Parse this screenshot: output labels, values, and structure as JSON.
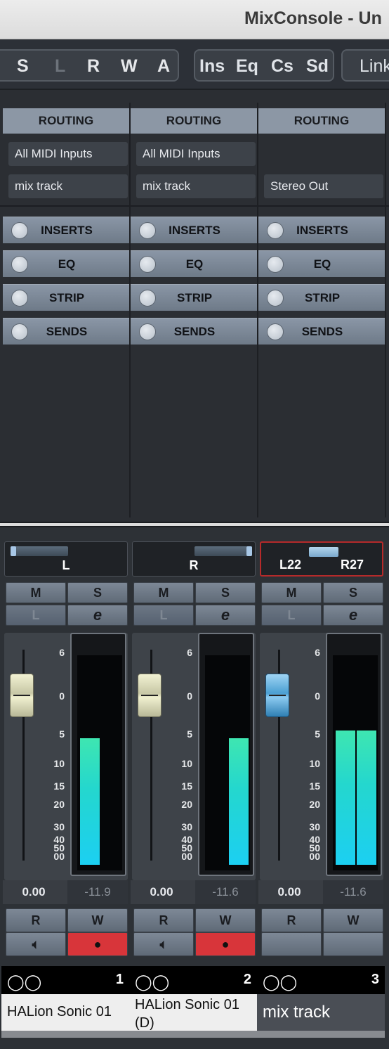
{
  "window": {
    "title": "MixConsole - Un"
  },
  "toolbar": {
    "state_buttons": [
      "S",
      "L",
      "R",
      "W",
      "A"
    ],
    "view_buttons": [
      "Ins",
      "Eq",
      "Cs",
      "Sd"
    ],
    "link_label": "Link"
  },
  "sections": {
    "routing": "ROUTING",
    "inserts": "INSERTS",
    "eq": "EQ",
    "strip": "STRIP",
    "sends": "SENDS"
  },
  "channels": [
    {
      "number": "1",
      "name": "HALion Sonic 01",
      "input": "All MIDI Inputs",
      "output": "mix track",
      "pan": "L",
      "mute": "M",
      "solo": "S",
      "listen": "L",
      "edit": "e",
      "volume": "0.00",
      "peak": "-11.9",
      "read": "R",
      "write": "W",
      "meter_level": 0.62,
      "color": "#f0f0cf"
    },
    {
      "number": "2",
      "name": "HALion Sonic 01 (D)",
      "input": "All MIDI Inputs",
      "output": "mix track",
      "pan": "R",
      "mute": "M",
      "solo": "S",
      "listen": "L",
      "edit": "e",
      "volume": "0.00",
      "peak": "-11.6",
      "read": "R",
      "write": "W",
      "meter_level": 0.62,
      "color": "#f0f0cf"
    },
    {
      "number": "3",
      "name": "mix track",
      "input": "",
      "output": "Stereo Out",
      "pan_left": "L22",
      "pan_right": "R27",
      "mute": "M",
      "solo": "S",
      "listen": "L",
      "edit": "e",
      "volume": "0.00",
      "peak": "-11.6",
      "read": "R",
      "write": "W",
      "meter_level": 0.66,
      "color": "#4a9fd2"
    }
  ],
  "fader_scale": [
    "6",
    "0",
    "5",
    "10",
    "15",
    "20",
    "30",
    "40",
    "50",
    "00"
  ]
}
